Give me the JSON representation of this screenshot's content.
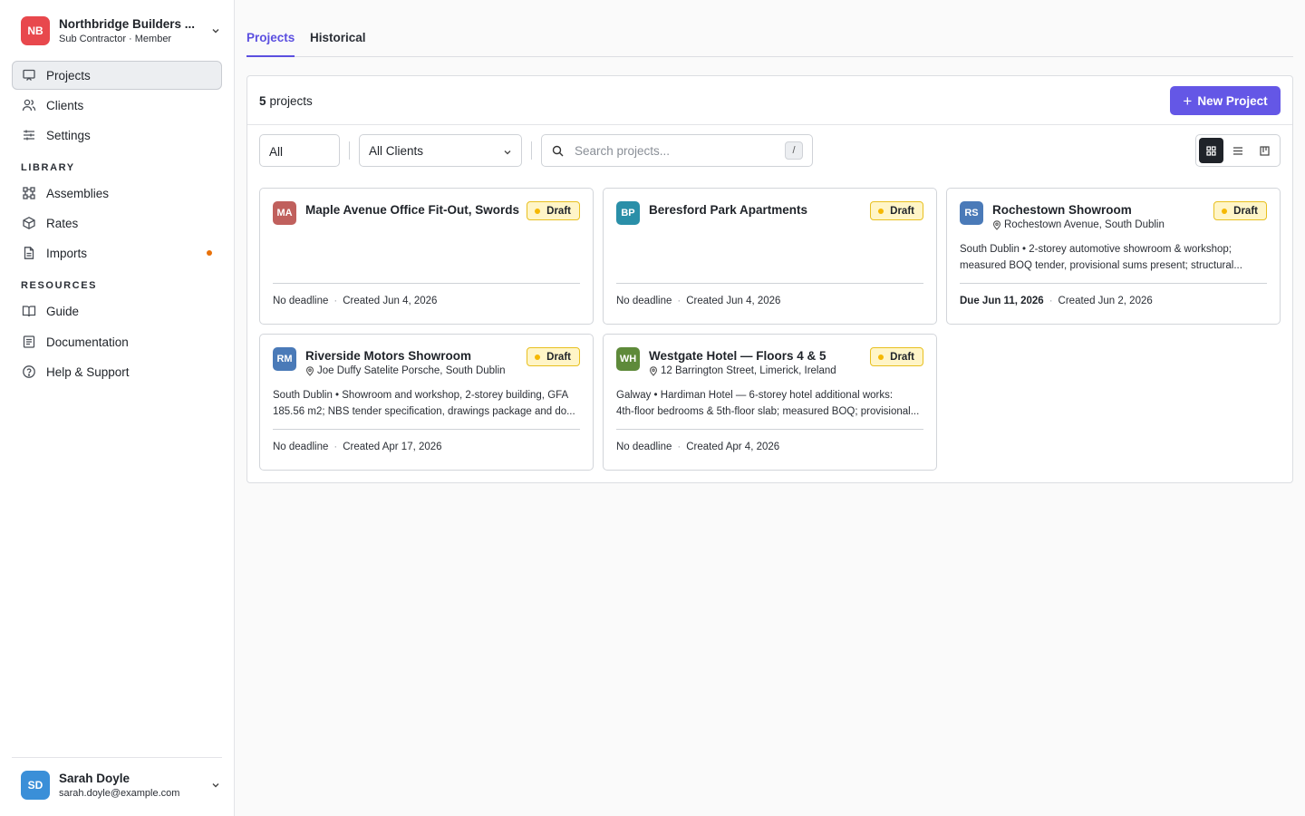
{
  "org": {
    "initials": "NB",
    "name": "Northbridge Builders ...",
    "role": "Sub Contractor · Member",
    "color": "#e8484d"
  },
  "nav": {
    "main": [
      {
        "label": "Projects",
        "icon": "presentation-icon",
        "active": true
      },
      {
        "label": "Clients",
        "icon": "users-icon"
      },
      {
        "label": "Settings",
        "icon": "sliders-icon"
      }
    ],
    "library_label": "LIBRARY",
    "library": [
      {
        "label": "Assemblies",
        "icon": "component-icon"
      },
      {
        "label": "Rates",
        "icon": "box-icon"
      },
      {
        "label": "Imports",
        "icon": "file-icon",
        "indicator": true
      }
    ],
    "resources_label": "RESOURCES",
    "resources": [
      {
        "label": "Guide",
        "icon": "book-open-icon"
      },
      {
        "label": "Documentation",
        "icon": "document-icon"
      },
      {
        "label": "Help & Support",
        "icon": "help-circle-icon"
      }
    ]
  },
  "user": {
    "initials": "SD",
    "name": "Sarah Doyle",
    "email": "sarah.doyle@example.com",
    "color": "#3a8fd8"
  },
  "tabs": [
    {
      "label": "Projects",
      "active": true
    },
    {
      "label": "Historical"
    }
  ],
  "toolbar": {
    "count": "5",
    "count_label": "projects",
    "new_button": "New Project",
    "status_filter": "All",
    "client_filter": "All Clients",
    "search_placeholder": "Search projects...",
    "search_shortcut": "/",
    "view_modes": [
      "grid",
      "list",
      "board"
    ],
    "active_view": "grid"
  },
  "projects": [
    {
      "initials": "MA",
      "color": "#c0605d",
      "title": "Maple Avenue Office Fit-Out, Swords",
      "status": "Draft",
      "location": "",
      "desc1": "",
      "desc2": "",
      "deadline": "No deadline",
      "created": "Created Jun 4, 2026"
    },
    {
      "initials": "BP",
      "color": "#2a8fa8",
      "title": "Beresford Park Apartments",
      "status": "Draft",
      "location": "",
      "desc1": "",
      "desc2": "",
      "deadline": "No deadline",
      "created": "Created Jun 4, 2026"
    },
    {
      "initials": "RS",
      "color": "#4a7ab8",
      "title": "Rochestown Showroom",
      "status": "Draft",
      "location": "Rochestown Avenue, South Dublin",
      "desc1": "South Dublin • 2-storey automotive showroom & workshop;",
      "desc2": "measured BOQ tender, provisional sums present; structural...",
      "deadline": "Due Jun 11, 2026",
      "deadline_bold": true,
      "created": "Created Jun 2, 2026"
    },
    {
      "initials": "RM",
      "color": "#4a7ab8",
      "title": "Riverside Motors Showroom",
      "status": "Draft",
      "location": "Joe Duffy Satelite Porsche, South Dublin",
      "desc1": "South Dublin • Showroom and workshop, 2-storey building, GFA",
      "desc2": "185.56 m2; NBS tender specification, drawings package and do...",
      "deadline": "No deadline",
      "created": "Created Apr 17, 2026"
    },
    {
      "initials": "WH",
      "color": "#5e8a3a",
      "title": "Westgate Hotel — Floors 4 & 5",
      "status": "Draft",
      "location": "12 Barrington Street, Limerick, Ireland",
      "desc1": "Galway • Hardiman Hotel — 6-storey hotel additional works:",
      "desc2": "4th-floor bedrooms & 5th-floor slab; measured BOQ; provisional...",
      "deadline": "No deadline",
      "created": "Created Apr 4, 2026"
    }
  ]
}
